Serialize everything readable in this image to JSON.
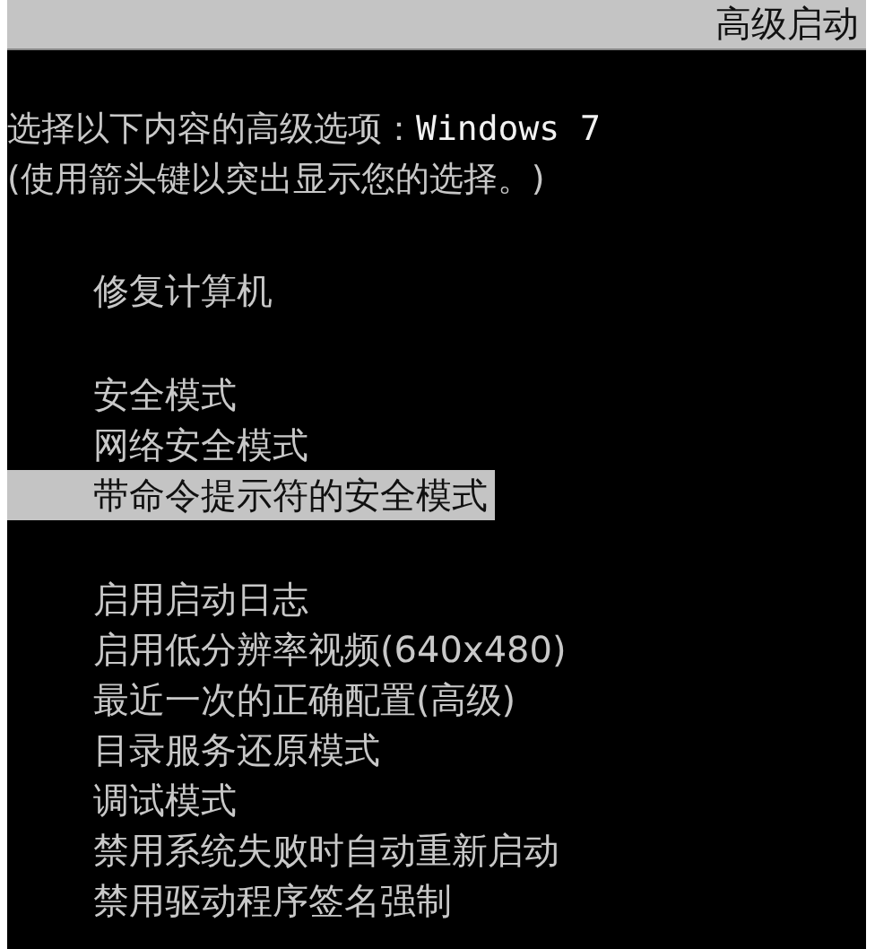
{
  "header": {
    "title": "高级启动"
  },
  "prompt": {
    "label": "选择以下内容的高级选项：",
    "os_name": "Windows 7",
    "hint": "(使用箭头键以突出显示您的选择。)"
  },
  "groups": [
    {
      "items": [
        {
          "label": "修复计算机",
          "selected": false
        }
      ]
    },
    {
      "items": [
        {
          "label": "安全模式",
          "selected": false
        },
        {
          "label": "网络安全模式",
          "selected": false
        },
        {
          "label": "带命令提示符的安全模式",
          "selected": true
        }
      ]
    },
    {
      "items": [
        {
          "label": "启用启动日志",
          "selected": false
        },
        {
          "label": "启用低分辨率视频(640x480)",
          "selected": false
        },
        {
          "label": "最近一次的正确配置(高级)",
          "selected": false
        },
        {
          "label": "目录服务还原模式",
          "selected": false
        },
        {
          "label": "调试模式",
          "selected": false
        },
        {
          "label": "禁用系统失败时自动重新启动",
          "selected": false
        },
        {
          "label": "禁用驱动程序签名强制",
          "selected": false
        }
      ]
    }
  ]
}
